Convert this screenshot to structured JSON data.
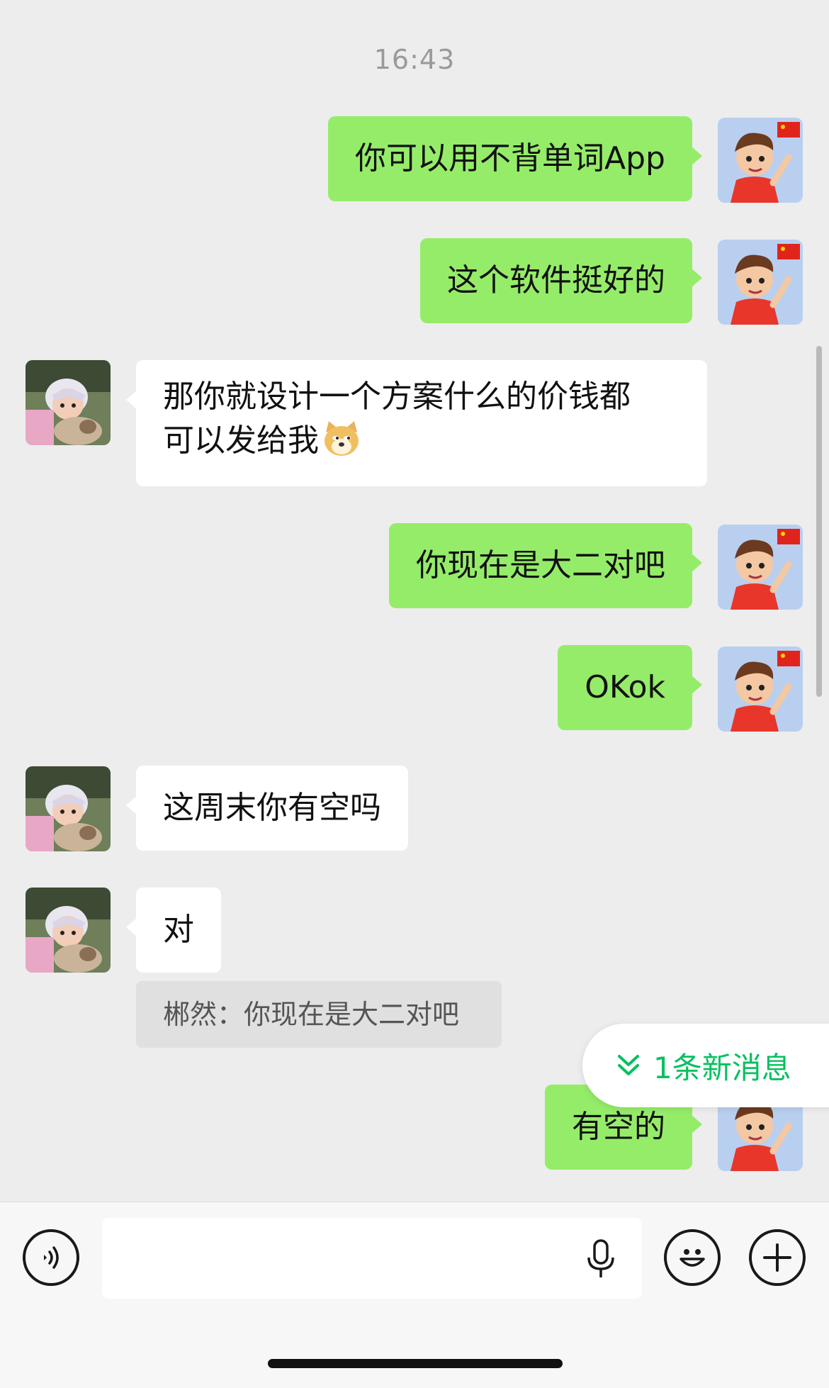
{
  "timestamp": "16:43",
  "messages": [
    {
      "side": "out",
      "text": "你可以用不背单词App"
    },
    {
      "side": "out",
      "text": "这个软件挺好的"
    },
    {
      "side": "in",
      "line1": "那你就设计一个方案什么的价钱都",
      "line2": "可以发给我",
      "emoji": "doge-emoji"
    },
    {
      "side": "out",
      "text": "你现在是大二对吧"
    },
    {
      "side": "out",
      "text": "OKok"
    },
    {
      "side": "in",
      "text": "这周末你有空吗"
    },
    {
      "side": "in",
      "text": "对",
      "quote": "郴然：你现在是大二对吧"
    },
    {
      "side": "out",
      "text": "有空的"
    }
  ],
  "new_message_banner": {
    "label": "1条新消息",
    "icon": "double-chevron-down-icon"
  },
  "colors": {
    "outgoing_bubble": "#95ec69",
    "incoming_bubble": "#ffffff",
    "accent": "#07c160",
    "background": "#ededed"
  },
  "input_bar": {
    "left_icon": "voice-icon",
    "mic_icon": "microphone-icon",
    "emoji_icon": "smiley-icon",
    "more_icon": "plus-icon"
  }
}
